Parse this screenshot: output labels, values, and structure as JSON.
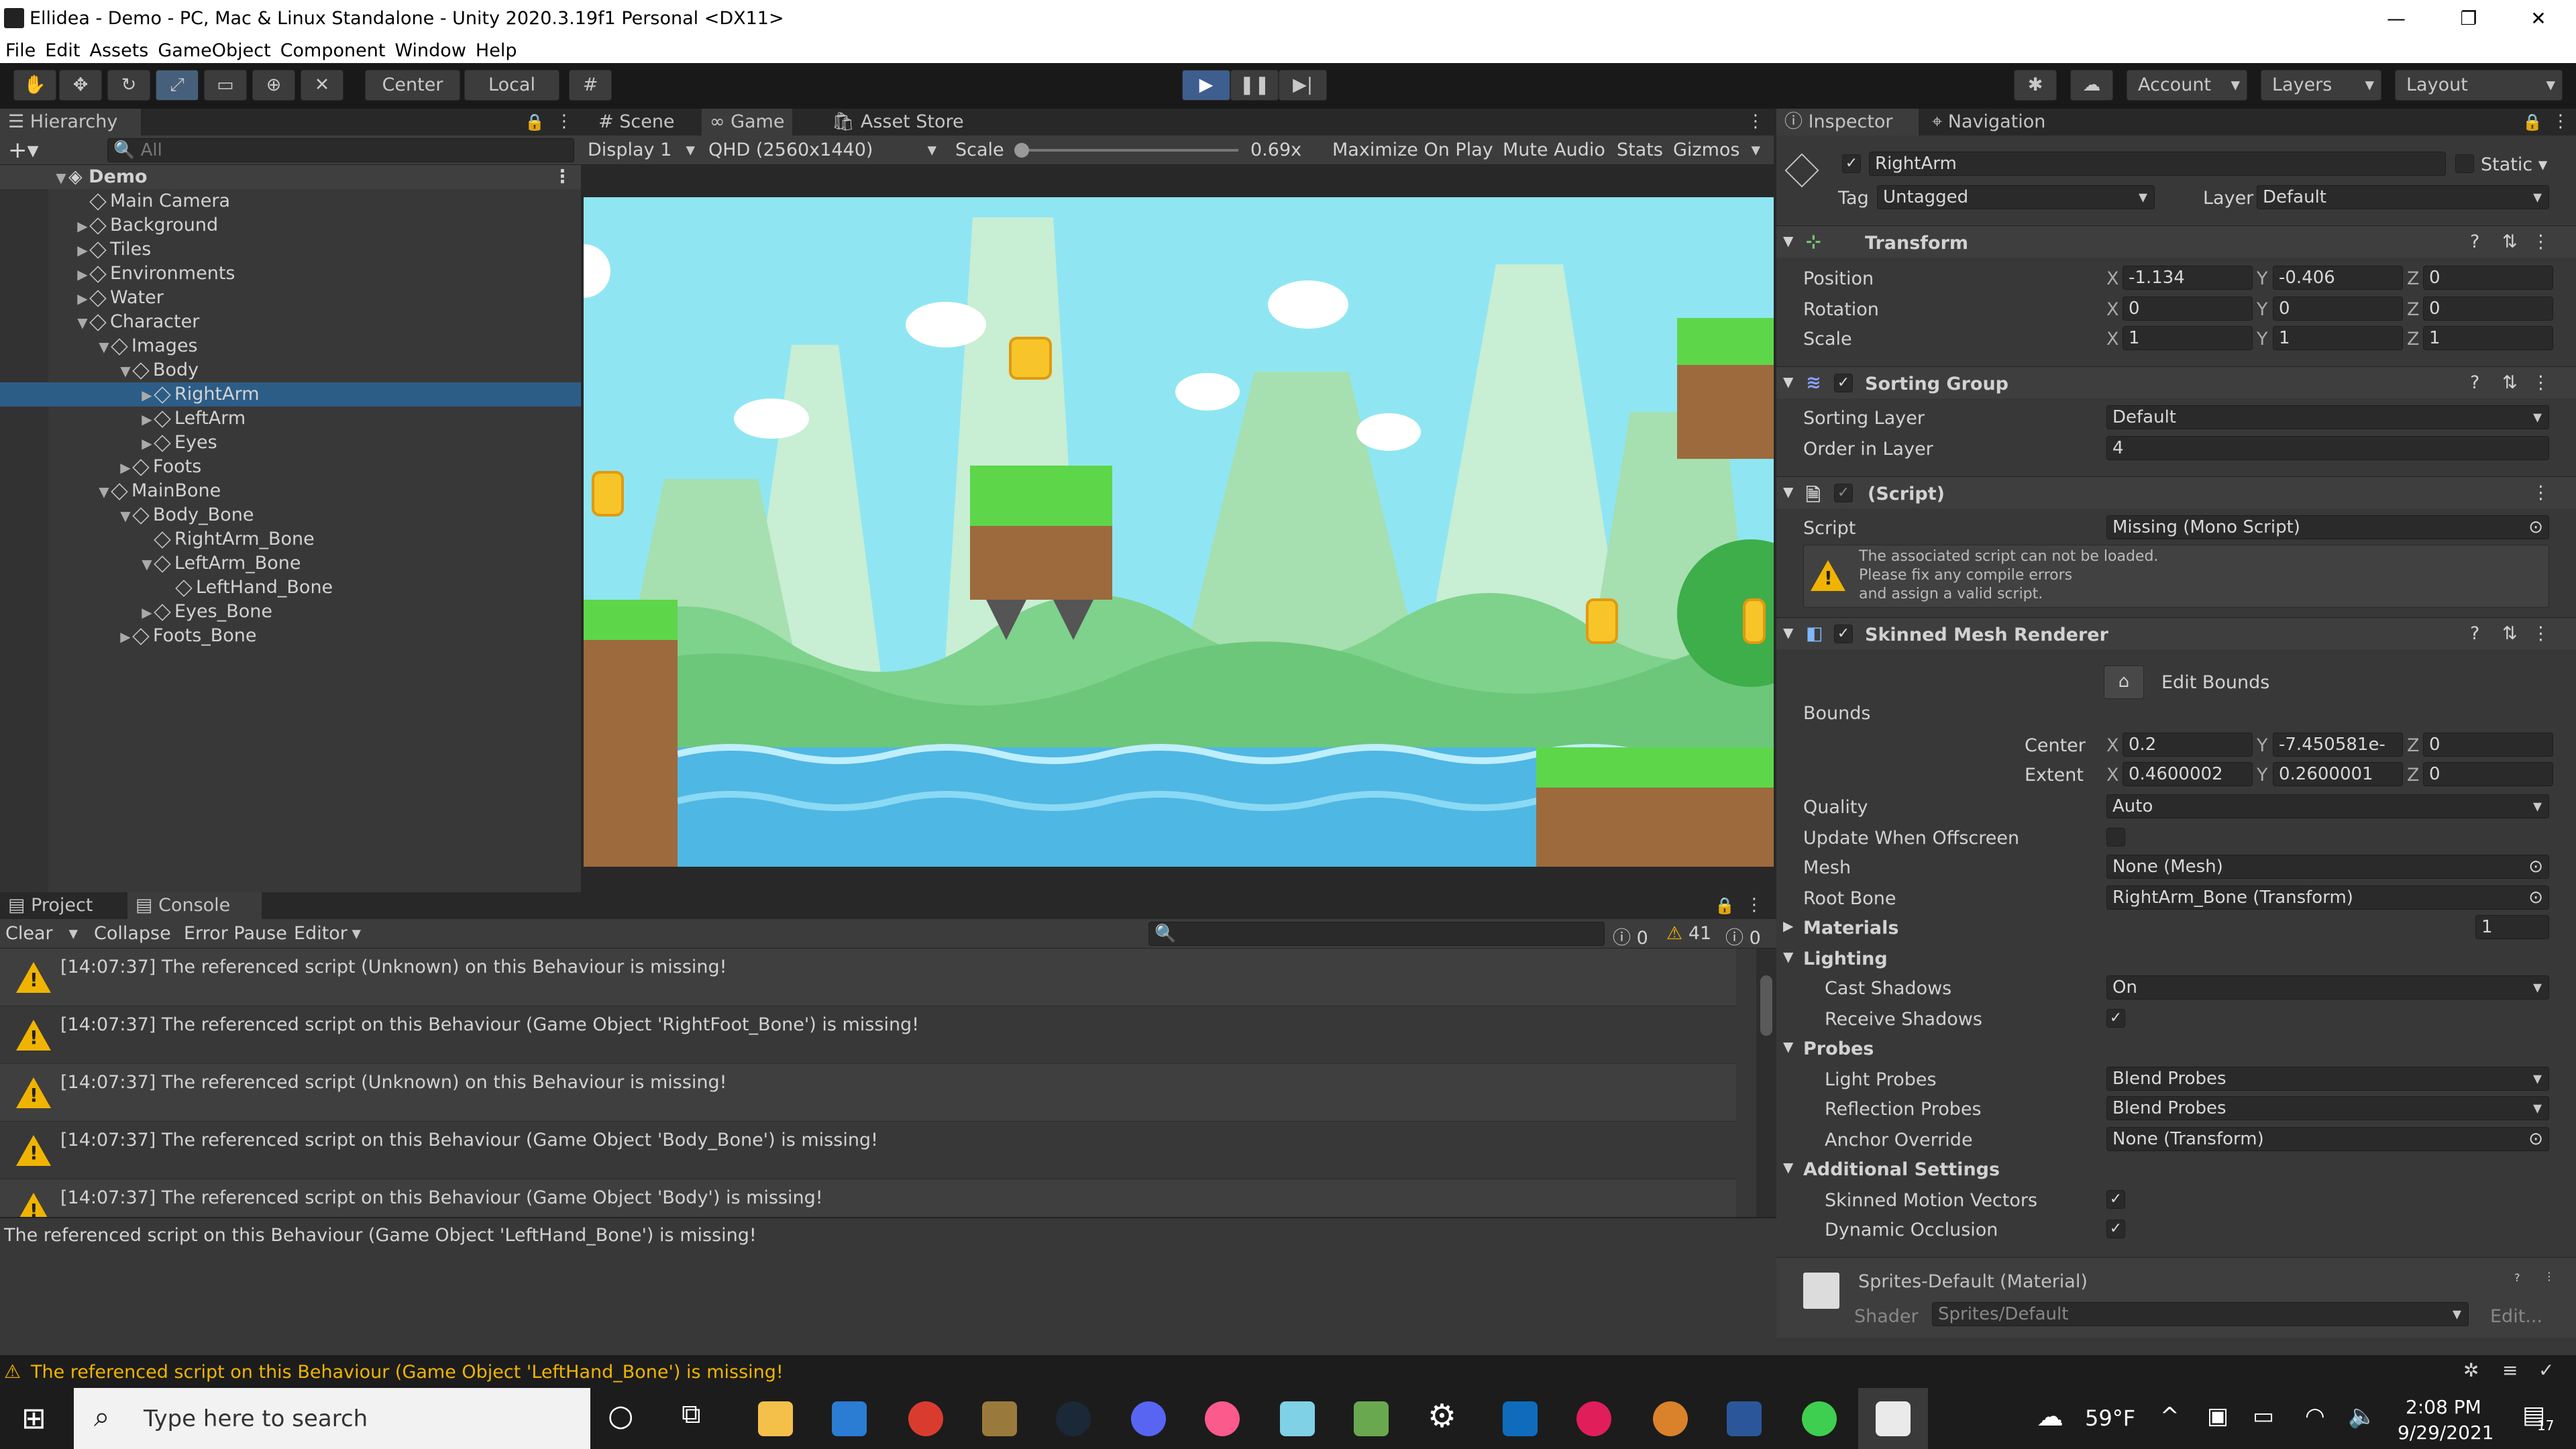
{
  "window": {
    "title": "Ellidea - Demo - PC, Mac & Linux Standalone - Unity 2020.3.19f1 Personal <DX11>",
    "controls": [
      "—",
      "❐",
      "✕"
    ]
  },
  "menu": [
    "File",
    "Edit",
    "Assets",
    "GameObject",
    "Component",
    "Window",
    "Help"
  ],
  "toolbar": {
    "pivot": "Center",
    "space": "Local",
    "account": "Account",
    "layers": "Layers",
    "layout": "Layout"
  },
  "hierarchy": {
    "tab": "Hierarchy",
    "search_placeholder": "All",
    "scene": "Demo",
    "items": [
      {
        "label": "Main Camera",
        "depth": 1,
        "arrow": ""
      },
      {
        "label": "Background",
        "depth": 1,
        "arrow": "▶"
      },
      {
        "label": "Tiles",
        "depth": 1,
        "arrow": "▶"
      },
      {
        "label": "Environments",
        "depth": 1,
        "arrow": "▶"
      },
      {
        "label": "Water",
        "depth": 1,
        "arrow": "▶"
      },
      {
        "label": "Character",
        "depth": 1,
        "arrow": "▼"
      },
      {
        "label": "Images",
        "depth": 2,
        "arrow": "▼"
      },
      {
        "label": "Body",
        "depth": 3,
        "arrow": "▼"
      },
      {
        "label": "RightArm",
        "depth": 4,
        "arrow": "▶",
        "selected": true
      },
      {
        "label": "LeftArm",
        "depth": 4,
        "arrow": "▶"
      },
      {
        "label": "Eyes",
        "depth": 4,
        "arrow": "▶"
      },
      {
        "label": "Foots",
        "depth": 3,
        "arrow": "▶"
      },
      {
        "label": "MainBone",
        "depth": 2,
        "arrow": "▼"
      },
      {
        "label": "Body_Bone",
        "depth": 3,
        "arrow": "▼"
      },
      {
        "label": "RightArm_Bone",
        "depth": 4,
        "arrow": ""
      },
      {
        "label": "LeftArm_Bone",
        "depth": 4,
        "arrow": "▼"
      },
      {
        "label": "LeftHand_Bone",
        "depth": 5,
        "arrow": ""
      },
      {
        "label": "Eyes_Bone",
        "depth": 4,
        "arrow": "▶"
      },
      {
        "label": "Foots_Bone",
        "depth": 3,
        "arrow": "▶"
      }
    ]
  },
  "game": {
    "tabs": [
      "Scene",
      "Game",
      "Asset Store"
    ],
    "display": "Display 1",
    "resolution": "QHD (2560x1440)",
    "scale_label": "Scale",
    "scale_value": "0.69x",
    "maximize": "Maximize On Play",
    "mute": "Mute Audio",
    "stats": "Stats",
    "gizmos": "Gizmos"
  },
  "console": {
    "tabs": [
      "Project",
      "Console"
    ],
    "clear": "Clear",
    "collapse": "Collapse",
    "error_pause": "Error Pause",
    "editor": "Editor",
    "count_info": "0",
    "count_warn": "41",
    "count_error": "0",
    "logs": [
      "[14:07:37] The referenced script (Unknown) on this Behaviour is missing!",
      "[14:07:37] The referenced script on this Behaviour (Game Object 'RightFoot_Bone') is missing!",
      "[14:07:37] The referenced script (Unknown) on this Behaviour is missing!",
      "[14:07:37] The referenced script on this Behaviour (Game Object 'Body_Bone') is missing!",
      "[14:07:37] The referenced script on this Behaviour (Game Object 'Body') is missing!"
    ],
    "detail": "The referenced script on this Behaviour (Game Object 'LeftHand_Bone') is missing!",
    "status": "The referenced script on this Behaviour (Game Object 'LeftHand_Bone') is missing!"
  },
  "inspector": {
    "tabs": [
      "Inspector",
      "Navigation"
    ],
    "object_name": "RightArm",
    "static_label": "Static",
    "tag_label": "Tag",
    "tag_value": "Untagged",
    "layer_label": "Layer",
    "layer_value": "Default",
    "transform": {
      "title": "Transform",
      "position_label": "Position",
      "position": [
        "-1.134",
        "-0.406",
        "0"
      ],
      "rotation_label": "Rotation",
      "rotation": [
        "0",
        "0",
        "0"
      ],
      "scale_label": "Scale",
      "scale": [
        "1",
        "1",
        "1"
      ]
    },
    "sorting_group": {
      "title": "Sorting Group",
      "sorting_layer_label": "Sorting Layer",
      "sorting_layer": "Default",
      "order_label": "Order in Layer",
      "order": "4"
    },
    "script": {
      "title": "(Script)",
      "label": "Script",
      "value": "Missing (Mono Script)",
      "warning": [
        "The associated script can not be loaded.",
        "Please fix any compile errors",
        "and assign a valid script."
      ]
    },
    "smr": {
      "title": "Skinned Mesh Renderer",
      "edit_bounds": "Edit Bounds",
      "bounds_label": "Bounds",
      "center_label": "Center",
      "center": [
        "0.2",
        "-7.450581e-",
        "0"
      ],
      "extent_label": "Extent",
      "extent": [
        "0.4600002",
        "0.2600001",
        "0"
      ],
      "quality_label": "Quality",
      "quality": "Auto",
      "offscreen_label": "Update When Offscreen",
      "mesh_label": "Mesh",
      "mesh": "None (Mesh)",
      "root_label": "Root Bone",
      "root": "RightArm_Bone (Transform)",
      "materials_label": "Materials",
      "materials_count": "1",
      "lighting_label": "Lighting",
      "cast_label": "Cast Shadows",
      "cast": "On",
      "receive_label": "Receive Shadows",
      "probes_label": "Probes",
      "light_probes_label": "Light Probes",
      "light_probes": "Blend Probes",
      "reflection_label": "Reflection Probes",
      "reflection": "Blend Probes",
      "anchor_label": "Anchor Override",
      "anchor": "None (Transform)",
      "additional_label": "Additional Settings",
      "motion_label": "Skinned Motion Vectors",
      "occlusion_label": "Dynamic Occlusion"
    },
    "material": {
      "name": "Sprites-Default (Material)",
      "shader_label": "Shader",
      "shader": "Sprites/Default",
      "edit": "Edit..."
    }
  },
  "taskbar": {
    "search_placeholder": "Type here to search",
    "weather": "59°F",
    "time": "2:08 PM",
    "date": "9/29/2021",
    "notifications": "17"
  },
  "colors": {
    "accent": "#2c5d87",
    "play": "#3d5e8e",
    "warning": "#f0b400",
    "sky": "#8ee3f0"
  }
}
